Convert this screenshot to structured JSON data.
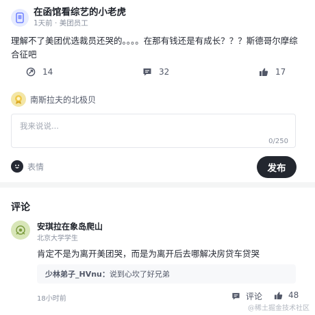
{
  "post": {
    "author_name": "在函馆看综艺的小老虎",
    "author_meta": "1天前 · 美团员工",
    "content": "理解不了美团优选裁员还哭的。。。。在那有钱还是有成长？？？斯德哥尔摩综合征吧",
    "actions": {
      "share_count": "14",
      "comment_count": "32",
      "like_count": "17"
    }
  },
  "reply_box": {
    "user_name": "南斯拉夫的北极贝",
    "placeholder": "我来说说...",
    "counter": "0/250",
    "emoji_label": "表情",
    "publish_label": "发布"
  },
  "comments": {
    "title": "评论",
    "items": [
      {
        "name": "安琪拉在象岛爬山",
        "title": "北京大学学生",
        "text": "肯定不是为离开美团哭，而是为离开后去哪解决房贷车贷哭",
        "sub_reply_name": "少林弟子_HVnu：",
        "sub_reply_text": "说到心坎了好兄弟",
        "time": "18小时前",
        "reply_label": "评论",
        "like_count": "48"
      }
    ]
  },
  "watermark": "@稀土掘金技术社区",
  "colors": {
    "publish_bg": "#23272f",
    "text_primary": "#1d2129",
    "text_secondary": "#8a919f",
    "divider": "#f4f5f5"
  }
}
